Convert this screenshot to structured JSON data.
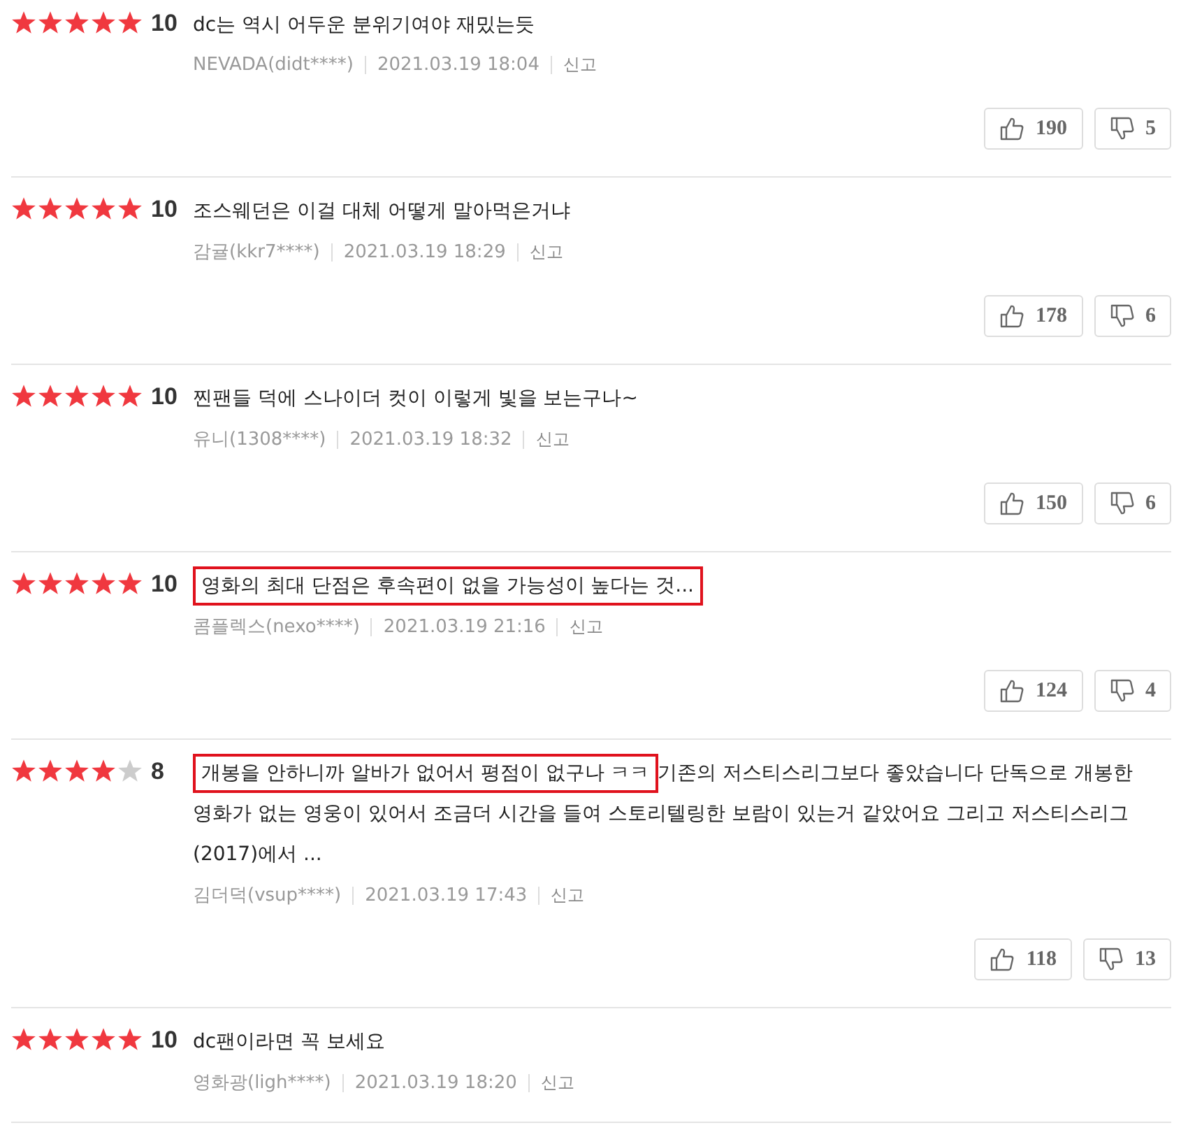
{
  "reviews": [
    {
      "stars": 5,
      "score": "10",
      "body": [
        {
          "text": "dc는 역시 어두운 분위기여야 재밌는듯",
          "marked": false
        }
      ],
      "author": "NEVADA(didt****)",
      "date": "2021.03.19 18:04",
      "report": "신고",
      "likes": "190",
      "dislikes": "5"
    },
    {
      "stars": 5,
      "score": "10",
      "body": [
        {
          "text": "조스웨던은 이걸 대체 어떻게 말아먹은거냐",
          "marked": false
        }
      ],
      "author": "감귤(kkr7****)",
      "date": "2021.03.19 18:29",
      "report": "신고",
      "likes": "178",
      "dislikes": "6"
    },
    {
      "stars": 5,
      "score": "10",
      "body": [
        {
          "text": "찐팬들 덕에 스나이더 컷이 이렇게 빛을 보는구나~",
          "marked": false
        }
      ],
      "author": "유니(1308****)",
      "date": "2021.03.19 18:32",
      "report": "신고",
      "likes": "150",
      "dislikes": "6"
    },
    {
      "stars": 5,
      "score": "10",
      "body": [
        {
          "text": "영화의 최대 단점은 후속편이 없을 가능성이 높다는 것...",
          "marked": true
        }
      ],
      "author": "콤플렉스(nexo****)",
      "date": "2021.03.19 21:16",
      "report": "신고",
      "likes": "124",
      "dislikes": "4"
    },
    {
      "stars": 4,
      "score": "8",
      "body": [
        {
          "text": "개봉을 안하니까 알바가 없어서 평점이 없구나 ㅋㅋ",
          "marked": true
        },
        {
          "text": "기존의 저스티스리그보다 좋았습니다 단독으로 개봉한 영화가 없는 영웅이 있어서 조금더 시간을 들여 스토리텔링한 보람이 있는거 같았어요 그리고 저스티스리그(2017)에서 ...",
          "marked": false
        }
      ],
      "author": "김더덕(vsup****)",
      "date": "2021.03.19 17:43",
      "report": "신고",
      "likes": "118",
      "dislikes": "13"
    },
    {
      "stars": 5,
      "score": "10",
      "body": [
        {
          "text": "dc팬이라면 꼭 보세요",
          "marked": false
        }
      ],
      "author": "영화광(ligh****)",
      "date": "2021.03.19 18:20",
      "report": "신고"
    }
  ]
}
